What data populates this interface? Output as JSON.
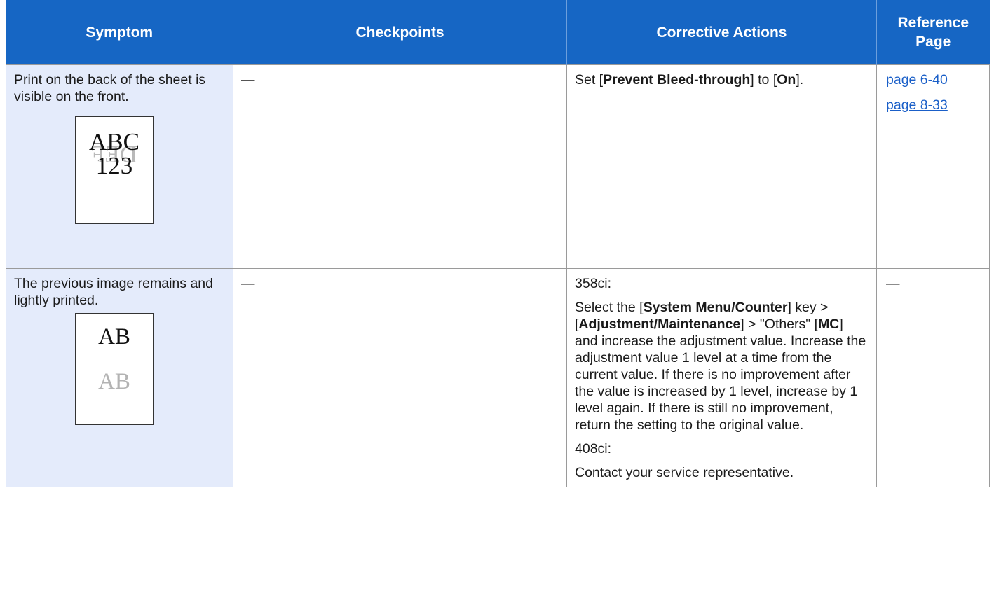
{
  "header": {
    "symptom": "Symptom",
    "checkpoints": "Checkpoints",
    "corrective": "Corrective Actions",
    "reference_line1": "Reference",
    "reference_line2": "Page"
  },
  "rows": [
    {
      "symptom": "Print on the back of the sheet is visible on the front.",
      "illustration": {
        "front_line1": "ABC",
        "front_line2": "123",
        "ghost": "DEF"
      },
      "checkpoints": "—",
      "corrective": {
        "p1": "Set [",
        "b1": "Prevent Bleed-through",
        "p2": "] to [",
        "b2": "On",
        "p3": "]."
      },
      "refs": [
        "page 6-40",
        "page 8-33"
      ]
    },
    {
      "symptom": "The previous image remains and lightly printed.",
      "illustration": {
        "dark": "AB",
        "light": "AB"
      },
      "checkpoints": "—",
      "corrective": {
        "model1": "358ci:",
        "t1": "Select the [",
        "b1": "System Menu/Counter",
        "t2": "] key > [",
        "b2": "Adjustment/Maintenance",
        "t3": "] > \"Others\" [",
        "b3": "MC",
        "t4": "] and increase the adjustment value. Increase the adjustment value 1 level at a time from the current value. If there is no improvement after the value is increased by 1 level, increase by 1 level again. If there is still no improvement, return the setting to the original value.",
        "model2": "408ci:",
        "contact": "Contact your service representative."
      },
      "ref": "—"
    }
  ]
}
